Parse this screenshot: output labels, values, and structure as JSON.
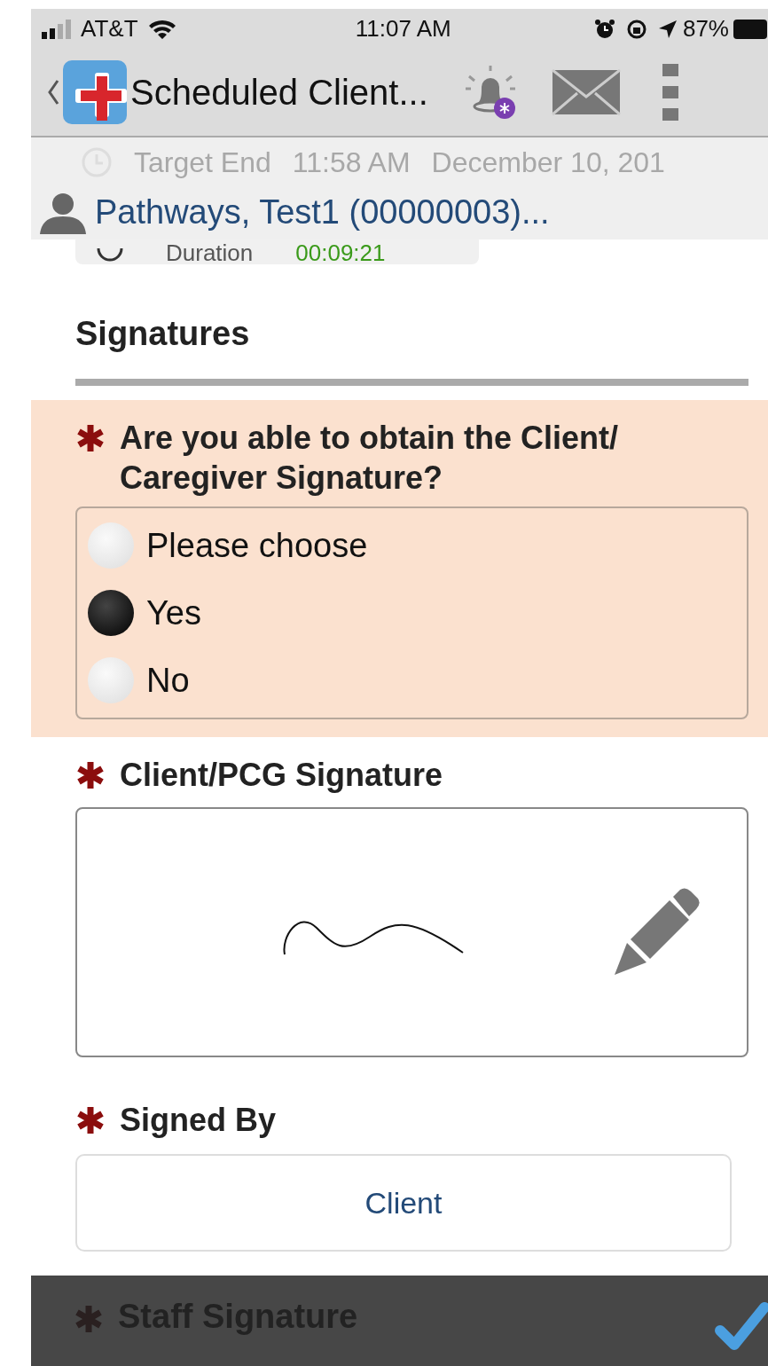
{
  "status_bar": {
    "carrier": "AT&T",
    "time": "11:07 AM",
    "battery": "87%"
  },
  "nav": {
    "title": "Scheduled Client..."
  },
  "visit": {
    "target_end_label": "Target End",
    "target_end_time": "11:58 AM",
    "target_end_date": "December 10, 201",
    "client": "Pathways, Test1 (00000003)...",
    "duration_label": "Duration",
    "duration": "00:09:21"
  },
  "section": {
    "title": "Signatures"
  },
  "question": {
    "required": true,
    "label": "Are you able to obtain the Client/ Caregiver Signature?",
    "options": [
      {
        "label": "Please choose",
        "selected": false
      },
      {
        "label": "Yes",
        "selected": true
      },
      {
        "label": "No",
        "selected": false
      }
    ]
  },
  "signature": {
    "required": true,
    "label": "Client/PCG Signature"
  },
  "signed_by": {
    "required": true,
    "label": "Signed By",
    "value": "Client"
  },
  "footer": {
    "required": true,
    "label": "Staff Signature"
  }
}
